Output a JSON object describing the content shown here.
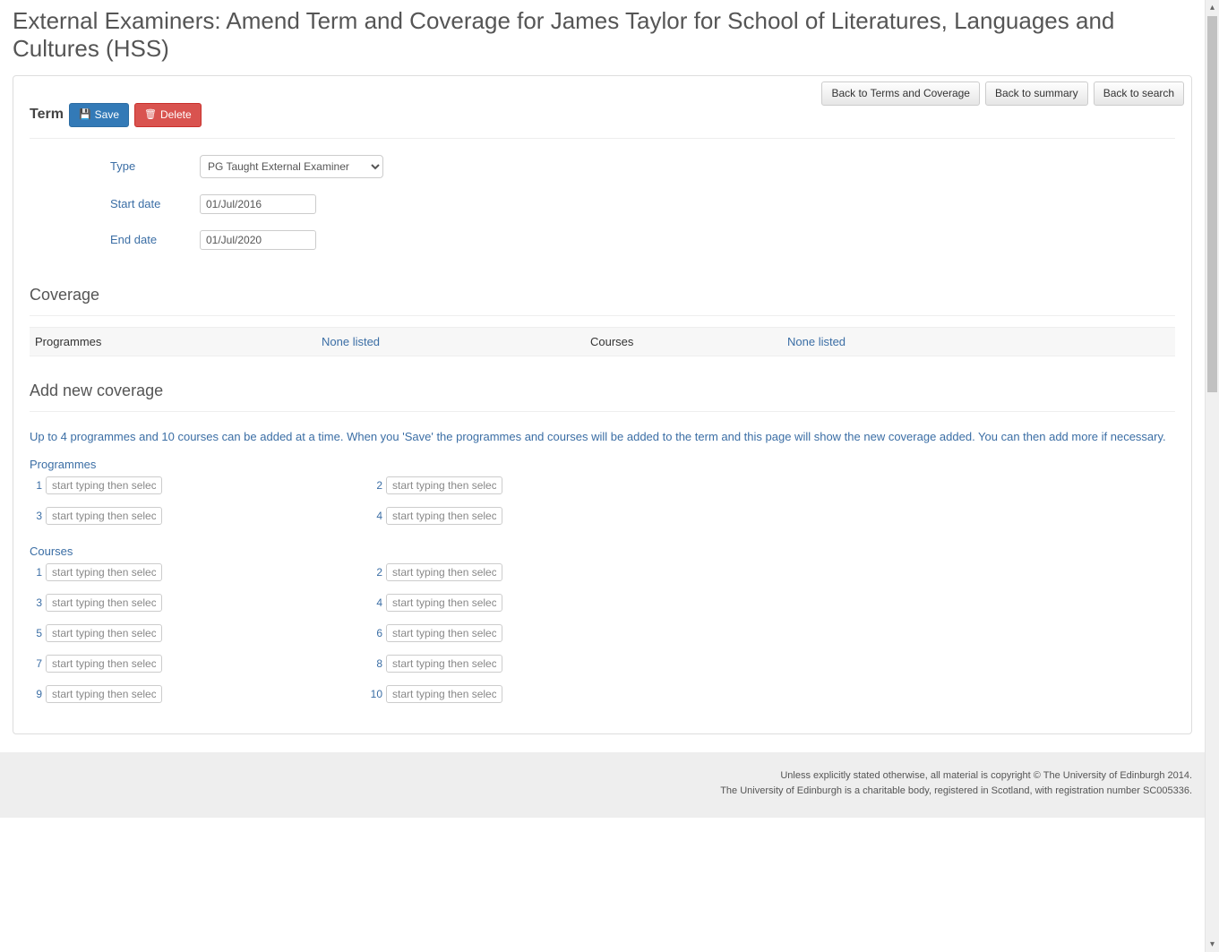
{
  "header": {
    "title": "External Examiners: Amend Term and Coverage for James Taylor for School of Literatures, Languages and Cultures (HSS)"
  },
  "top_buttons": {
    "back_terms": "Back to Terms and Coverage",
    "back_summary": "Back to summary",
    "back_search": "Back to search"
  },
  "term_section": {
    "heading": "Term",
    "save_label": "Save",
    "delete_label": "Delete",
    "type_label": "Type",
    "type_value": "PG Taught External Examiner",
    "start_label": "Start date",
    "start_value": "01/Jul/2016",
    "end_label": "End date",
    "end_value": "01/Jul/2020"
  },
  "coverage_section": {
    "heading": "Coverage",
    "programmes_label": "Programmes",
    "programmes_value": "None listed",
    "courses_label": "Courses",
    "courses_value": "None listed"
  },
  "add_section": {
    "heading": "Add new coverage",
    "info": "Up to 4 programmes and 10 courses can be added at a time. When you 'Save' the programmes and courses will be added to the term and this page will show the new coverage added. You can then add more if necessary.",
    "programmes_label": "Programmes",
    "courses_label": "Courses",
    "placeholder": "start typing then selec",
    "programme_nums": [
      "1",
      "2",
      "3",
      "4"
    ],
    "course_nums": [
      "1",
      "2",
      "3",
      "4",
      "5",
      "6",
      "7",
      "8",
      "9",
      "10"
    ]
  },
  "footer": {
    "line1": "Unless explicitly stated otherwise, all material is copyright © The University of Edinburgh 2014.",
    "line2": "The University of Edinburgh is a charitable body, registered in Scotland, with registration number SC005336."
  }
}
